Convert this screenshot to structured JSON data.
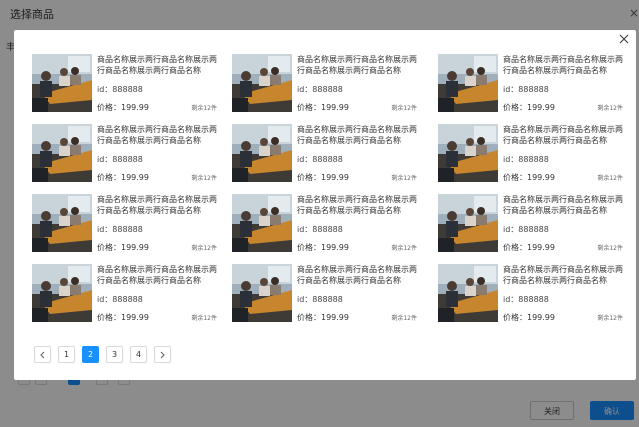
{
  "background_page": {
    "title": "选择商品",
    "tab_hint": "丰",
    "close_button": "关闭",
    "confirm_button": "确认"
  },
  "modal": {
    "products": [
      {
        "name": "商品名称展示两行商品名称展示两行商品名称展示两行商品名称",
        "id_text": "id：888888",
        "price_text": "价格：199.99",
        "stock_text": "剩余12件"
      },
      {
        "name": "商品名称展示两行商品名称展示两行商品名称展示两行商品名称",
        "id_text": "id：888888",
        "price_text": "价格：199.99",
        "stock_text": "剩余12件"
      },
      {
        "name": "商品名称展示两行商品名称展示两行商品名称展示两行商品名称",
        "id_text": "id：888888",
        "price_text": "价格：199.99",
        "stock_text": "剩余12件"
      },
      {
        "name": "商品名称展示两行商品名称展示两行商品名称展示两行商品名称",
        "id_text": "id：888888",
        "price_text": "价格：199.99",
        "stock_text": "剩余12件"
      },
      {
        "name": "商品名称展示两行商品名称展示两行商品名称展示两行商品名称",
        "id_text": "id：888888",
        "price_text": "价格：199.99",
        "stock_text": "剩余12件"
      },
      {
        "name": "商品名称展示两行商品名称展示两行商品名称展示两行商品名称",
        "id_text": "id：888888",
        "price_text": "价格：199.99",
        "stock_text": "剩余12件"
      },
      {
        "name": "商品名称展示两行商品名称展示两行商品名称展示两行商品名称",
        "id_text": "id：888888",
        "price_text": "价格：199.99",
        "stock_text": "剩余12件"
      },
      {
        "name": "商品名称展示两行商品名称展示两行商品名称展示两行商品名称",
        "id_text": "id：888888",
        "price_text": "价格：199.99",
        "stock_text": "剩余12件"
      },
      {
        "name": "商品名称展示两行商品名称展示两行商品名称展示两行商品名称",
        "id_text": "id：888888",
        "price_text": "价格：199.99",
        "stock_text": "剩余12件"
      },
      {
        "name": "商品名称展示两行商品名称展示两行商品名称展示两行商品名称",
        "id_text": "id：888888",
        "price_text": "价格：199.99",
        "stock_text": "剩余12件"
      },
      {
        "name": "商品名称展示两行商品名称展示两行商品名称展示两行商品名称",
        "id_text": "id：888888",
        "price_text": "价格：199.99",
        "stock_text": "剩余12件"
      },
      {
        "name": "商品名称展示两行商品名称展示两行商品名称展示两行商品名称",
        "id_text": "id：888888",
        "price_text": "价格：199.99",
        "stock_text": "剩余12件"
      }
    ],
    "pagination": {
      "prev_icon": "chevron-left-icon",
      "next_icon": "chevron-right-icon",
      "pages": [
        "1",
        "2",
        "3",
        "4"
      ],
      "current_page": "2"
    },
    "close_icon": "close-icon"
  },
  "colors": {
    "accent": "#1890ff",
    "mask": "rgba(0,0,0,0.45)"
  }
}
